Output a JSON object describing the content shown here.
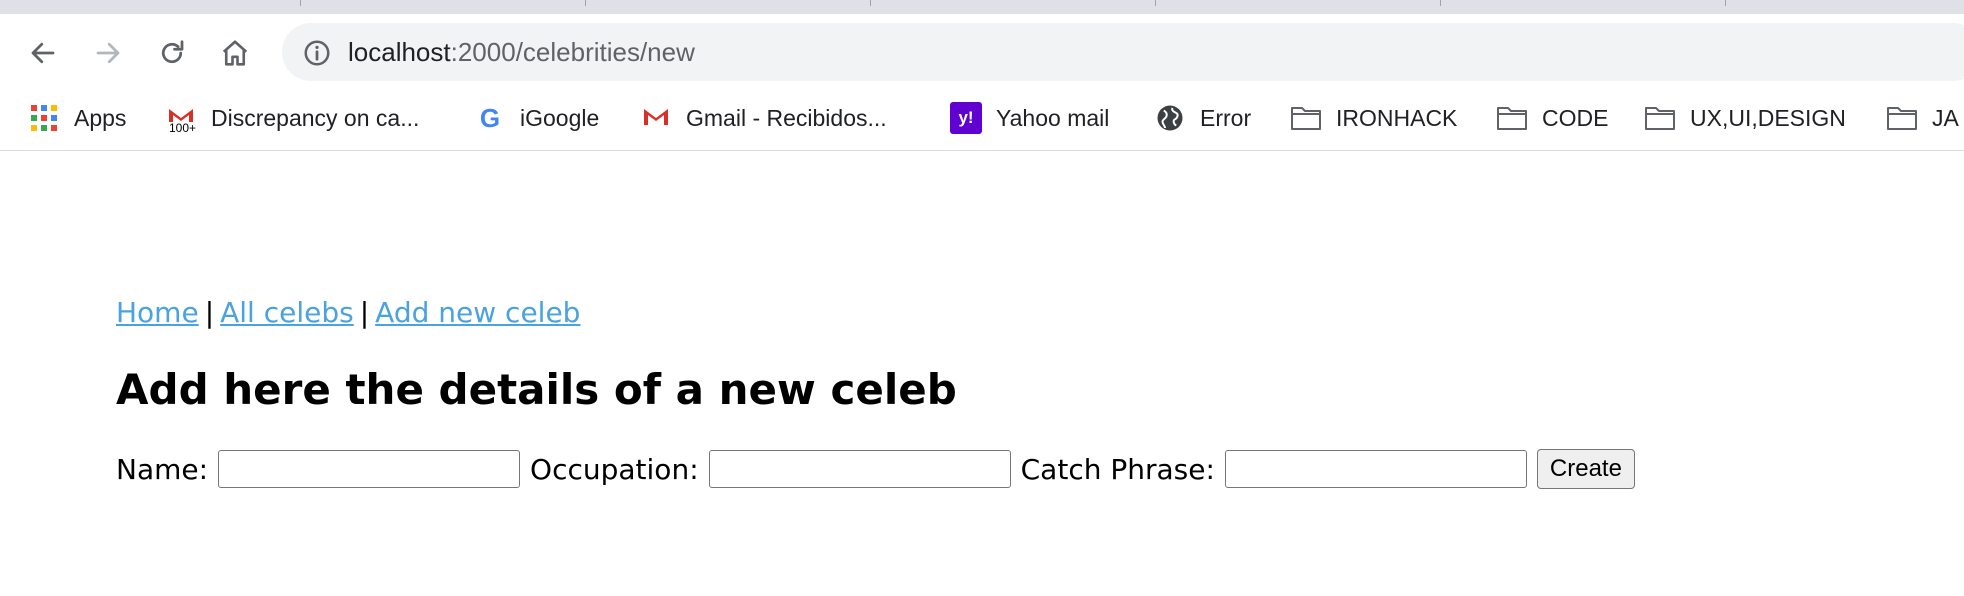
{
  "browser": {
    "url": {
      "host": "localhost",
      "path": ":2000/celebrities/new"
    },
    "bookmarks": [
      {
        "label": "Apps",
        "icon": "apps-grid-icon"
      },
      {
        "label": "Discrepancy on ca...",
        "icon": "gmail-100-icon",
        "badge": "100+"
      },
      {
        "label": "iGoogle",
        "icon": "google-g-icon",
        "glyph": "G"
      },
      {
        "label": "Gmail - Recibidos...",
        "icon": "gmail-icon"
      },
      {
        "label": "Yahoo mail",
        "icon": "yahoo-icon",
        "glyph": "y!"
      },
      {
        "label": "Error",
        "icon": "globe-icon"
      },
      {
        "label": "IRONHACK",
        "icon": "folder-icon"
      },
      {
        "label": "CODE",
        "icon": "folder-icon"
      },
      {
        "label": "UX,UI,DESIGN",
        "icon": "folder-icon"
      },
      {
        "label": "JA",
        "icon": "folder-icon"
      }
    ]
  },
  "nav": {
    "home": "Home",
    "separator": "|",
    "all": "All celebs",
    "add": "Add new celeb"
  },
  "page": {
    "title": "Add here the details of a new celeb"
  },
  "form": {
    "name_label": "Name:",
    "occupation_label": "Occupation:",
    "catchphrase_label": "Catch Phrase:",
    "submit_label": "Create"
  },
  "colors": {
    "link": "#4aa3df",
    "yahoo": "#6001d2",
    "omnibox": "#f1f3f4"
  }
}
